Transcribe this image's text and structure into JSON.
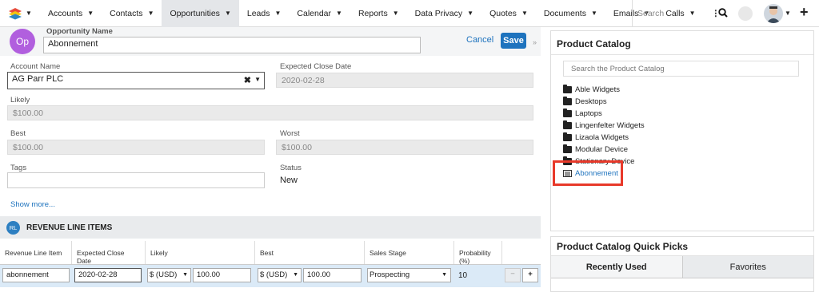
{
  "nav": {
    "items": [
      "Accounts",
      "Contacts",
      "Opportunities",
      "Leads",
      "Calendar",
      "Reports",
      "Data Privacy",
      "Quotes",
      "Documents",
      "Emails",
      "Calls"
    ],
    "active": "Opportunities",
    "more": "⋮",
    "search_placeholder": "Search",
    "plus": "+"
  },
  "record": {
    "icon": "Op",
    "name_label": "Opportunity Name",
    "name_value": "Abonnement",
    "cancel": "Cancel",
    "save": "Save",
    "account_label": "Account Name",
    "account_value": "AG Parr PLC",
    "close_date_label": "Expected Close Date",
    "close_date_value": "2020-02-28",
    "likely_label": "Likely",
    "likely_value": "$100.00",
    "best_label": "Best",
    "best_value": "$100.00",
    "worst_label": "Worst",
    "worst_value": "$100.00",
    "tags_label": "Tags",
    "status_label": "Status",
    "status_value": "New",
    "show_more": "Show more..."
  },
  "rli": {
    "icon": "RL",
    "title": "REVENUE LINE ITEMS",
    "headers": [
      "Revenue Line Item",
      "Expected Close Date",
      "Likely",
      "Best",
      "Sales Stage",
      "Probability (%)"
    ],
    "row": {
      "item": "abonnement",
      "date": "2020-02-28",
      "currency1": "$ (USD)",
      "likely": "100.00",
      "currency2": "$ (USD)",
      "best": "100.00",
      "stage": "Prospecting",
      "probability": "10",
      "minus": "−",
      "plus": "+"
    }
  },
  "catalog": {
    "title": "Product Catalog",
    "search_placeholder": "Search the Product Catalog",
    "folders": [
      "Able Widgets",
      "Desktops",
      "Laptops",
      "Lingenfelter Widgets",
      "Lizaola Widgets",
      "Modular Device",
      "Stationary Device"
    ],
    "product": "Abonnement"
  },
  "quickpicks": {
    "title": "Product Catalog Quick Picks",
    "tabs": [
      "Recently Used",
      "Favorites"
    ]
  },
  "colors": {
    "accent": "#1e73be",
    "highlight_box": "#e8392a",
    "op_icon": "#b15fde"
  }
}
